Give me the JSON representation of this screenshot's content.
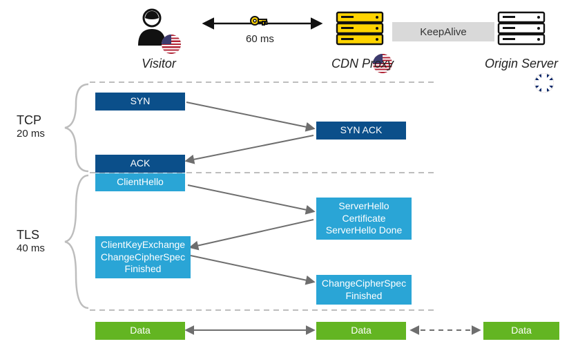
{
  "nodes": {
    "visitor": "Visitor",
    "cdn": "CDN Proxy",
    "origin": "Origin Server"
  },
  "rtt": {
    "label": "60 ms"
  },
  "keepalive": "KeepAlive",
  "phases": {
    "tcp": {
      "name": "TCP",
      "duration": "20 ms"
    },
    "tls": {
      "name": "TLS",
      "duration": "40 ms"
    }
  },
  "messages": {
    "syn": "SYN",
    "syn_ack": "SYN ACK",
    "ack": "ACK",
    "client_hello": "ClientHello",
    "server_hello_block": "ServerHello\nCertificate\nServerHello Done",
    "client_key_block": "ClientKeyExchange\nChangeCipherSpec\nFinished",
    "server_finish_block": "ChangeCipherSpec\nFinished",
    "data": "Data"
  }
}
